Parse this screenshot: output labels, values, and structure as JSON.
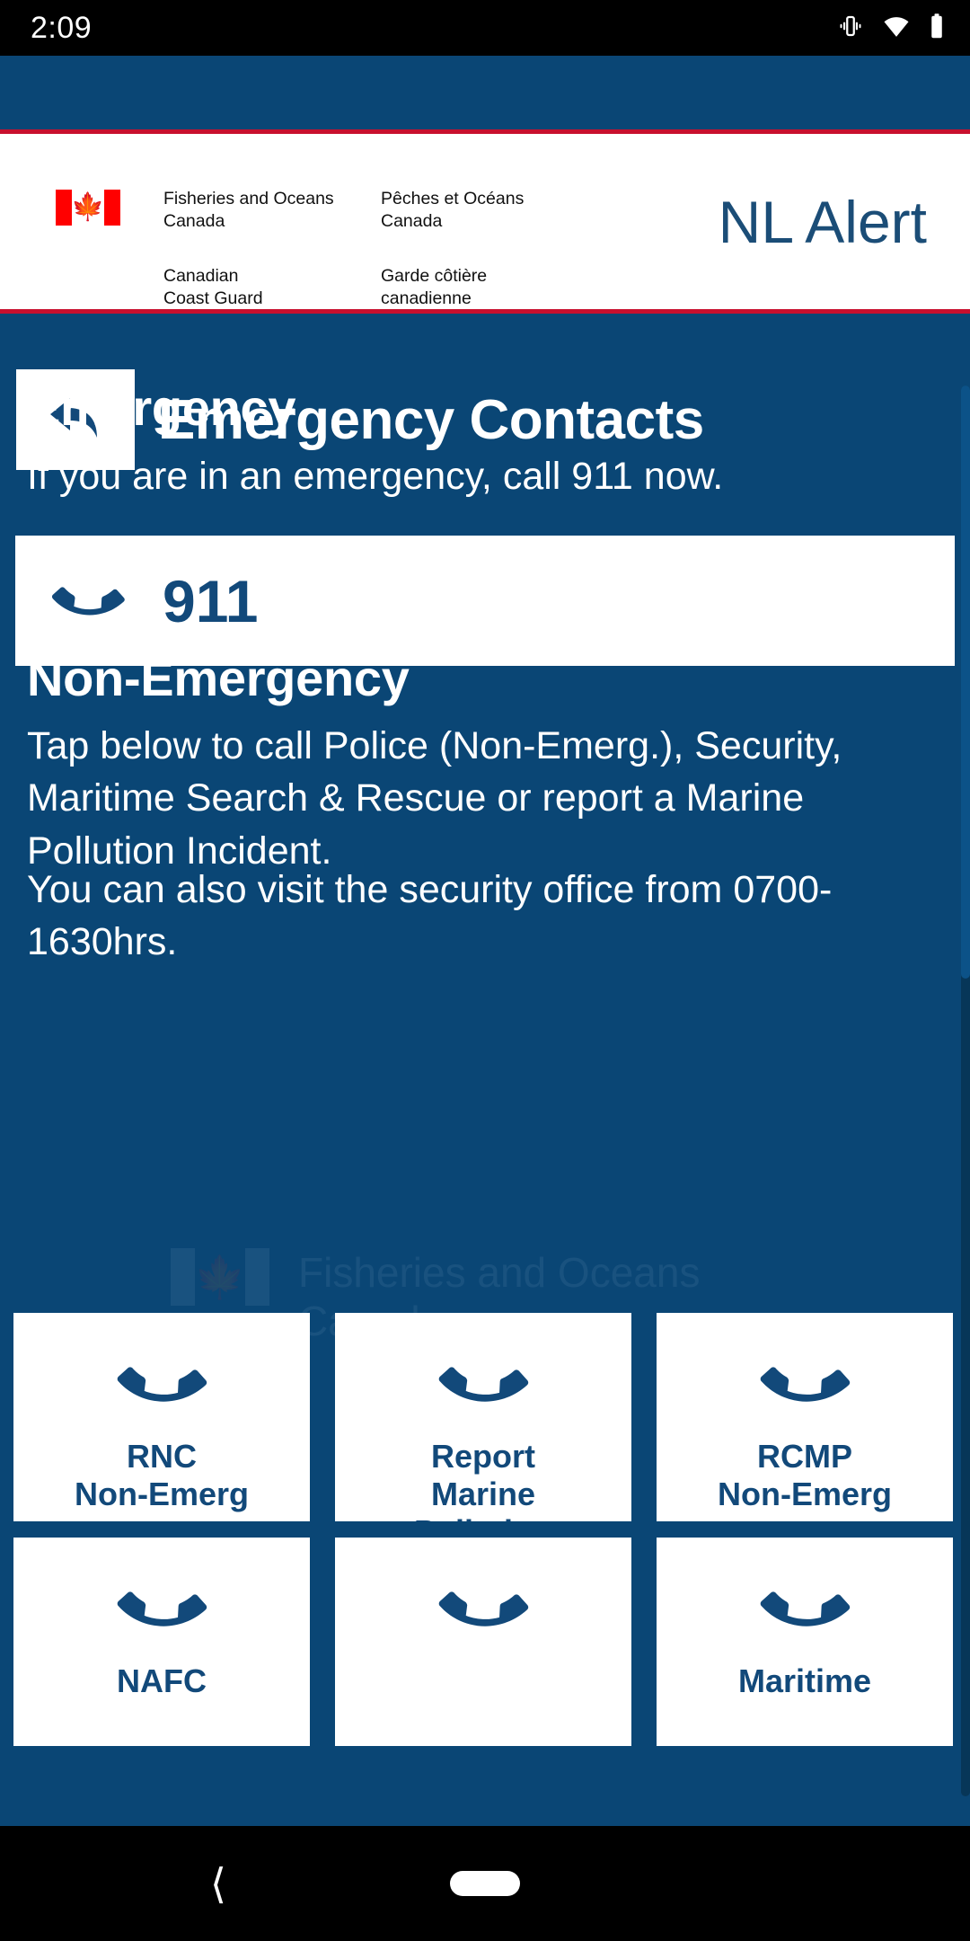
{
  "status_bar": {
    "time": "2:09",
    "icons": [
      "vibrate-icon",
      "wifi-icon",
      "battery-icon"
    ]
  },
  "banner": {
    "flag_alt": "canada-flag",
    "dept_en_line1": "Fisheries and Oceans",
    "dept_en_line2": "Canada",
    "dept_fr_line1": "Pêches et Océans",
    "dept_fr_line2": "Canada",
    "agency_en_line1": "Canadian",
    "agency_en_line2": "Coast Guard",
    "agency_fr_line1": "Garde côtière",
    "agency_fr_line2": "canadienne",
    "app_logo": "NL Alert",
    "accent_red": "#c8102e",
    "brand_blue": "#1b4d77"
  },
  "header": {
    "back_icon": "back-arrow-icon",
    "title": "Emergency Contacts"
  },
  "emergency": {
    "heading": "Emergency",
    "body": "If you are in an emergency, call 911 now.",
    "call_button": {
      "icon": "phone-icon",
      "label": "911"
    }
  },
  "non_emergency": {
    "heading": "Non-Emergency",
    "body": "Tap below to call Police (Non-Emerg.), Security, Maritime Search & Rescue or report a Marine Pollution Incident.",
    "office_hours_note": "You can also visit the security office from 0700-1630hrs.",
    "tiles": [
      {
        "icon": "phone-icon",
        "label": "RNC\nNon-Emerg"
      },
      {
        "icon": "phone-icon",
        "label": "Report\nMarine\nPollution"
      },
      {
        "icon": "phone-icon",
        "label": "RCMP\nNon-Emerg"
      },
      {
        "icon": "phone-icon",
        "label": "NAFC"
      },
      {
        "icon": "phone-icon",
        "label": ""
      },
      {
        "icon": "phone-icon",
        "label": "Maritime"
      }
    ]
  },
  "watermark": {
    "text": "Fisheries and Oceans\nCanada"
  },
  "nav_bar": {
    "back_icon": "nav-back-chevron-icon",
    "home_icon": "nav-home-pill-icon"
  },
  "colors": {
    "page_background": "#0a4675",
    "card_background": "#ffffff",
    "text_on_blue": "#ffffff",
    "accent_navy": "#12497a"
  }
}
